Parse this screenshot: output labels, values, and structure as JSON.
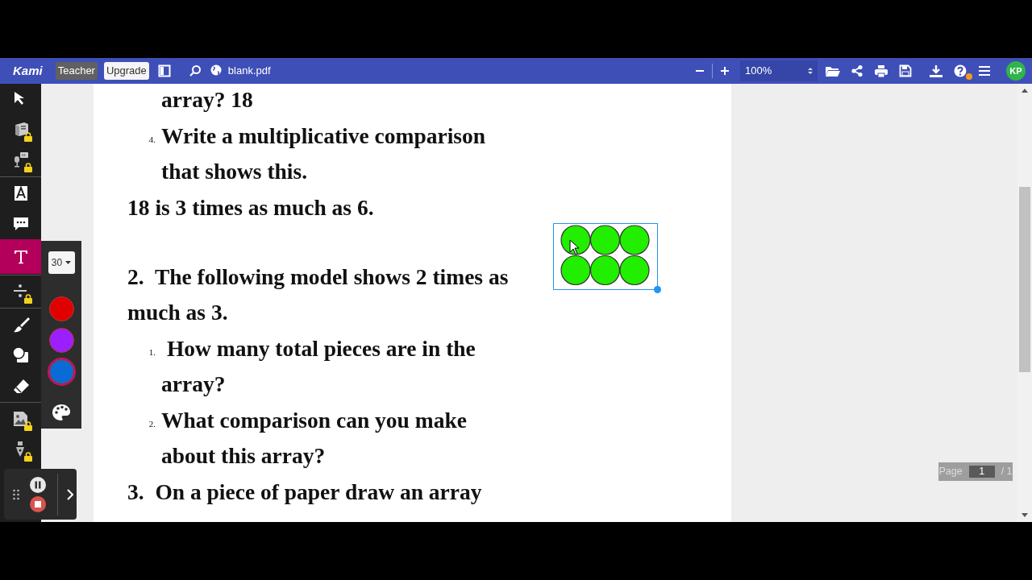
{
  "toolbar": {
    "logo": "Kami",
    "role_badge": "Teacher",
    "upgrade": "Upgrade",
    "filename": "blank.pdf",
    "zoom": "100%",
    "avatar": "KP",
    "help_notice": true
  },
  "tool_groups": [
    [
      {
        "kind": "select",
        "locked": false,
        "selected": false
      },
      {
        "kind": "book",
        "locked": true,
        "selected": false
      },
      {
        "kind": "voice",
        "locked": true,
        "selected": false
      }
    ],
    [
      {
        "kind": "textbox",
        "locked": false,
        "selected": false
      },
      {
        "kind": "comment",
        "locked": false,
        "selected": false
      },
      {
        "kind": "text",
        "locked": false,
        "selected": true
      }
    ],
    [
      {
        "kind": "equation",
        "locked": true,
        "selected": false
      }
    ],
    [
      {
        "kind": "brush",
        "locked": false,
        "selected": false
      },
      {
        "kind": "shape",
        "locked": false,
        "selected": false
      },
      {
        "kind": "eraser",
        "locked": false,
        "selected": false
      }
    ],
    [
      {
        "kind": "image",
        "locked": true,
        "selected": false
      },
      {
        "kind": "signature",
        "locked": true,
        "selected": false
      }
    ]
  ],
  "text_options": {
    "size": "30",
    "colors": [
      {
        "color": "#e00000",
        "selected": false
      },
      {
        "color": "#9b1fff",
        "selected": false
      },
      {
        "color": "#0a6ad6",
        "selected": true
      }
    ]
  },
  "document": {
    "lines": [
      {
        "kind": "indented",
        "text": "array? 18"
      },
      {
        "kind": "item",
        "marker": "4.",
        "text": "Write a multiplicative comparison"
      },
      {
        "kind": "indented",
        "text": "that shows this."
      },
      {
        "kind": "plain",
        "text": "18 is 3 times as much as 6."
      },
      {
        "kind": "plain",
        "text": "2.  The following model shows 2 times as",
        "space_before": true
      },
      {
        "kind": "plain",
        "text": "much as 3."
      },
      {
        "kind": "item",
        "marker": "1.",
        "text": " How many total pieces are in the"
      },
      {
        "kind": "indented",
        "text": "array?"
      },
      {
        "kind": "item",
        "marker": "2.",
        "text": "What comparison can you make"
      },
      {
        "kind": "indented",
        "text": "about this array?"
      },
      {
        "kind": "plain",
        "text": "3.  On a piece of paper draw an array"
      }
    ],
    "model": {
      "selected": true,
      "color": "#22ee00"
    }
  },
  "page_indicator": {
    "label": "Page",
    "value": "1",
    "total": "/ 1"
  }
}
